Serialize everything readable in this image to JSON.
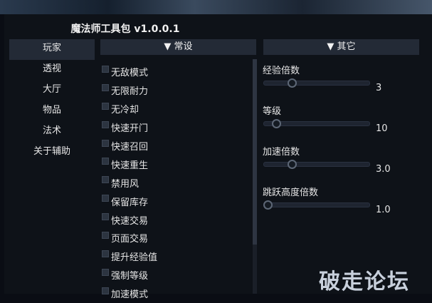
{
  "window": {
    "title": "魔法师工具包 v1.0.0.1"
  },
  "sidebar": {
    "items": [
      {
        "label": "玩家",
        "active": true
      },
      {
        "label": "透视"
      },
      {
        "label": "大厅"
      },
      {
        "label": "物品"
      },
      {
        "label": "法术"
      },
      {
        "label": "关于辅助"
      }
    ]
  },
  "sections": {
    "common": "▼ 常设",
    "other": "▼ 其它"
  },
  "checkboxes": [
    "无敌模式",
    "无限耐力",
    "无冷却",
    "快速开门",
    "快速召回",
    "快速重生",
    "禁用风",
    "保留库存",
    "快速交易",
    "页面交易",
    "提升经验值",
    "强制等级",
    "加速模式"
  ],
  "sliders": [
    {
      "label": "经验倍数",
      "value": "3",
      "fraction": 0.25
    },
    {
      "label": "等级",
      "value": "10",
      "fraction": 0.09
    },
    {
      "label": "加速倍数",
      "value": "3.0",
      "fraction": 0.25
    },
    {
      "label": "跳跃高度倍数",
      "value": "1.0",
      "fraction": 0.0
    }
  ],
  "watermark": "破走论坛",
  "colors": {
    "panel": "#0e1218",
    "header": "#232a36",
    "text": "#e6e6e6"
  }
}
